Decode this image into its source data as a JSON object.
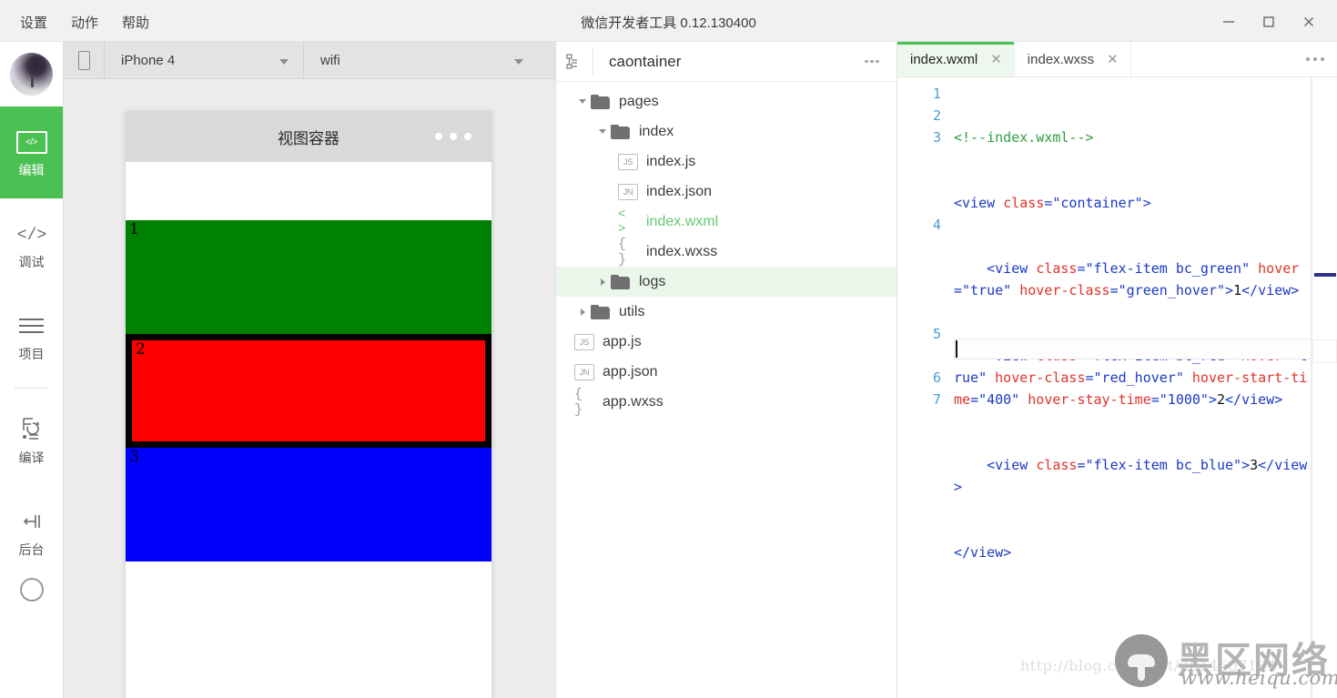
{
  "window": {
    "title": "微信开发者工具 0.12.130400",
    "menus": [
      "设置",
      "动作",
      "帮助"
    ],
    "controls": [
      "minimize-icon",
      "maximize-icon",
      "close-icon"
    ]
  },
  "rail": {
    "avatar": "user-avatar",
    "items": [
      {
        "label": "编辑",
        "icon": "code-box-icon",
        "active": true
      },
      {
        "label": "调试",
        "icon": "code-brackets-icon",
        "active": false
      },
      {
        "label": "项目",
        "icon": "hamburger-icon",
        "active": false
      },
      {
        "label": "编译",
        "icon": "compile-refresh-icon",
        "active": false
      },
      {
        "label": "后台",
        "icon": "background-icon",
        "active": false
      }
    ]
  },
  "simulator": {
    "device_icon": "phone-outline-icon",
    "device": "iPhone 4",
    "network": "wifi",
    "phone": {
      "nav_title": "视图容器",
      "nav_dots": "more-dots-icon",
      "blocks": [
        {
          "label": "1",
          "color": "#008000",
          "name": "flex-item-green"
        },
        {
          "label": "2",
          "color": "#ff0000",
          "name": "flex-item-red"
        },
        {
          "label": "3",
          "color": "#0000ff",
          "name": "flex-item-blue"
        }
      ]
    }
  },
  "tree": {
    "project_icon": "project-structure-icon",
    "project_name": "caontainer",
    "more_icon": "more-dots-icon",
    "nodes": [
      {
        "label": "pages",
        "type": "folder",
        "indent": 0,
        "expanded": true,
        "selected": false,
        "icon": "folder-icon",
        "arrow": "chevron-down-icon"
      },
      {
        "label": "index",
        "type": "folder",
        "indent": 1,
        "expanded": true,
        "selected": false,
        "icon": "folder-icon",
        "arrow": "chevron-down-icon"
      },
      {
        "label": "index.js",
        "type": "file",
        "indent": 2,
        "expanded": false,
        "selected": false,
        "icon": "js-file-icon",
        "badge": "JS"
      },
      {
        "label": "index.json",
        "type": "file",
        "indent": 2,
        "expanded": false,
        "selected": false,
        "icon": "json-file-icon",
        "badge": "JN"
      },
      {
        "label": "index.wxml",
        "type": "file",
        "indent": 2,
        "expanded": false,
        "selected": false,
        "icon": "wxml-file-icon",
        "badge": "< >",
        "active": true
      },
      {
        "label": "index.wxss",
        "type": "file",
        "indent": 2,
        "expanded": false,
        "selected": false,
        "icon": "wxss-file-icon",
        "badge": "{ }"
      },
      {
        "label": "logs",
        "type": "folder",
        "indent": 1,
        "expanded": false,
        "selected": true,
        "icon": "folder-icon",
        "arrow": "chevron-right-icon"
      },
      {
        "label": "utils",
        "type": "folder",
        "indent": 0,
        "expanded": false,
        "selected": false,
        "icon": "folder-icon",
        "arrow": "chevron-right-icon"
      },
      {
        "label": "app.js",
        "type": "file",
        "indent": 0,
        "expanded": false,
        "selected": false,
        "icon": "js-file-icon",
        "badge": "JS"
      },
      {
        "label": "app.json",
        "type": "file",
        "indent": 0,
        "expanded": false,
        "selected": false,
        "icon": "json-file-icon",
        "badge": "JN"
      },
      {
        "label": "app.wxss",
        "type": "file",
        "indent": 0,
        "expanded": false,
        "selected": false,
        "icon": "wxss-file-icon",
        "badge": "{ }"
      }
    ]
  },
  "editor": {
    "tabs": [
      {
        "label": "index.wxml",
        "active": true,
        "close_icon": "close-icon"
      },
      {
        "label": "index.wxss",
        "active": false,
        "close_icon": "close-icon"
      }
    ],
    "more_icon": "more-dots-icon",
    "line_numbers": [
      "1",
      "2",
      "3",
      "4",
      "5",
      "6",
      "7"
    ],
    "lines": [
      {
        "n": "1",
        "tokens": [
          {
            "t": "cmt",
            "v": "<!--index.wxml-->"
          }
        ]
      },
      {
        "n": "2",
        "tokens": [
          {
            "t": "tag",
            "v": "<view "
          },
          {
            "t": "attr",
            "v": "class"
          },
          {
            "t": "tag",
            "v": "="
          },
          {
            "t": "str",
            "v": "\"container\""
          },
          {
            "t": "tag",
            "v": ">"
          }
        ]
      },
      {
        "n": "3",
        "tokens": [
          {
            "t": "tag",
            "v": "    <view "
          },
          {
            "t": "attr",
            "v": "class"
          },
          {
            "t": "tag",
            "v": "="
          },
          {
            "t": "str",
            "v": "\"flex-item bc_green\""
          },
          {
            "t": "txt",
            "v": " "
          },
          {
            "t": "attr",
            "v": "hover"
          },
          {
            "t": "tag",
            "v": "="
          },
          {
            "t": "str",
            "v": "\"true\""
          },
          {
            "t": "txt",
            "v": " "
          },
          {
            "t": "attr",
            "v": "hover-class"
          },
          {
            "t": "tag",
            "v": "="
          },
          {
            "t": "str",
            "v": "\"green_hover\""
          },
          {
            "t": "tag",
            "v": ">"
          },
          {
            "t": "txt",
            "v": "1"
          },
          {
            "t": "tag",
            "v": "</view>"
          }
        ]
      },
      {
        "n": "4",
        "tokens": [
          {
            "t": "tag",
            "v": "    <view "
          },
          {
            "t": "attr",
            "v": "class"
          },
          {
            "t": "tag",
            "v": "="
          },
          {
            "t": "str",
            "v": "\"flex-item bc_red\""
          },
          {
            "t": "txt",
            "v": " "
          },
          {
            "t": "attr",
            "v": "hover"
          },
          {
            "t": "tag",
            "v": "="
          },
          {
            "t": "str",
            "v": "\"true\""
          },
          {
            "t": "txt",
            "v": " "
          },
          {
            "t": "attr",
            "v": "hover-class"
          },
          {
            "t": "tag",
            "v": "="
          },
          {
            "t": "str",
            "v": "\"red_hover\""
          },
          {
            "t": "txt",
            "v": " "
          },
          {
            "t": "attr",
            "v": "hover-start-time"
          },
          {
            "t": "tag",
            "v": "="
          },
          {
            "t": "str",
            "v": "\"400\""
          },
          {
            "t": "txt",
            "v": " "
          },
          {
            "t": "attr",
            "v": "hover-stay-time"
          },
          {
            "t": "tag",
            "v": "="
          },
          {
            "t": "str",
            "v": "\"1000\""
          },
          {
            "t": "tag",
            "v": ">"
          },
          {
            "t": "txt",
            "v": "2"
          },
          {
            "t": "tag",
            "v": "</view>"
          }
        ]
      },
      {
        "n": "5",
        "tokens": [
          {
            "t": "tag",
            "v": "    <view "
          },
          {
            "t": "attr",
            "v": "class"
          },
          {
            "t": "tag",
            "v": "="
          },
          {
            "t": "str",
            "v": "\"flex-item bc_blue\""
          },
          {
            "t": "tag",
            "v": ">"
          },
          {
            "t": "txt",
            "v": "3"
          },
          {
            "t": "tag",
            "v": "</view>"
          }
        ]
      },
      {
        "n": "6",
        "tokens": [
          {
            "t": "tag",
            "v": "</view>"
          }
        ]
      },
      {
        "n": "7",
        "tokens": []
      }
    ]
  },
  "watermark": {
    "url": "http://blog.csdn.net/u014607184",
    "brand_cn": "黑区网络",
    "site": "www.heiqu.com"
  },
  "colors": {
    "accent_green": "#4cc153",
    "tab_active_bg": "#eef7ee",
    "tree_selected_bg": "#eaf6ea",
    "block_green": "#008000",
    "block_red": "#ff0000",
    "block_blue": "#0000ff"
  }
}
